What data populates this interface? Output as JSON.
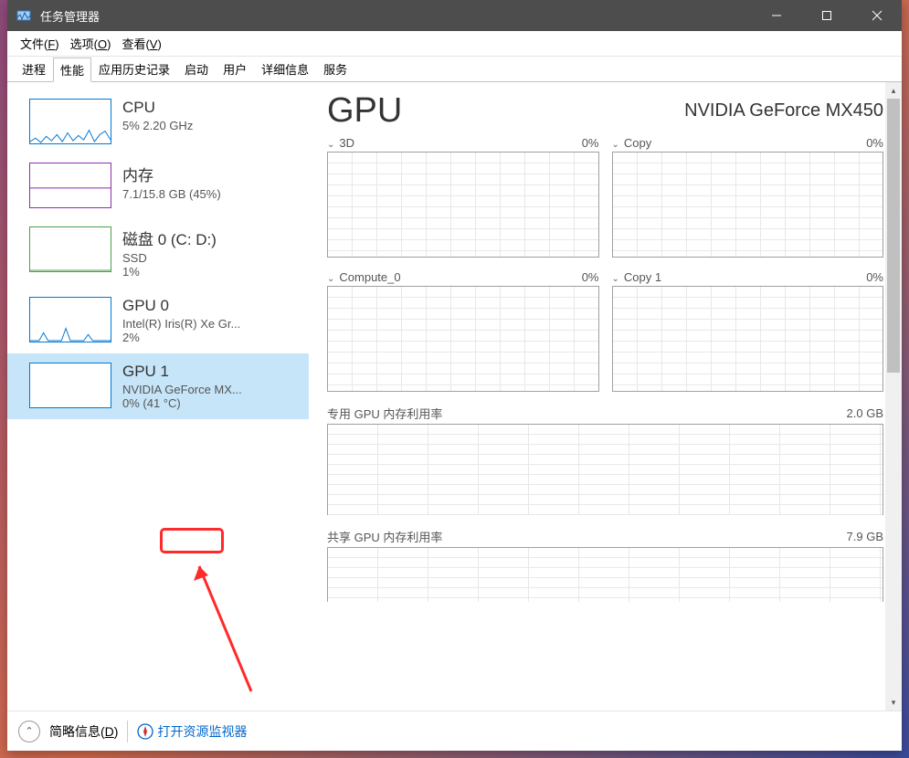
{
  "window": {
    "title": "任务管理器"
  },
  "menu": {
    "file": "文件(F)",
    "options": "选项(O)",
    "view": "查看(V)"
  },
  "tabs": {
    "processes": "进程",
    "performance": "性能",
    "app_history": "应用历史记录",
    "startup": "启动",
    "users": "用户",
    "details": "详细信息",
    "services": "服务"
  },
  "sidebar": {
    "cpu": {
      "title": "CPU",
      "sub": "5%  2.20 GHz"
    },
    "mem": {
      "title": "内存",
      "sub": "7.1/15.8 GB (45%)"
    },
    "disk": {
      "title": "磁盘 0 (C: D:)",
      "sub1": "SSD",
      "sub2": "1%"
    },
    "gpu0": {
      "title": "GPU 0",
      "sub1": "Intel(R) Iris(R) Xe Gr...",
      "sub2": "2%"
    },
    "gpu1": {
      "title": "GPU 1",
      "sub1": "NVIDIA GeForce MX...",
      "sub2a": "0% ",
      "sub2b": "(41 °C)"
    }
  },
  "main": {
    "title": "GPU",
    "subtitle": "NVIDIA GeForce MX450",
    "charts": {
      "3d": {
        "label": "3D",
        "value": "0%"
      },
      "copy": {
        "label": "Copy",
        "value": "0%"
      },
      "compute": {
        "label": "Compute_0",
        "value": "0%"
      },
      "copy1": {
        "label": "Copy 1",
        "value": "0%"
      },
      "dedicated": {
        "label": "专用 GPU 内存利用率",
        "value": "2.0 GB"
      },
      "shared": {
        "label": "共享 GPU 内存利用率",
        "value": "7.9 GB"
      }
    }
  },
  "statusbar": {
    "fewer": "简略信息(D)",
    "resmon": "打开资源监视器"
  },
  "chart_data": {
    "type": "line",
    "title": "GPU activity over time",
    "panels": [
      {
        "name": "3D",
        "ylim": [
          0,
          100
        ],
        "unit": "%",
        "current": 0,
        "series": [
          0,
          0,
          0,
          0,
          0,
          0,
          0,
          0,
          0,
          0
        ]
      },
      {
        "name": "Copy",
        "ylim": [
          0,
          100
        ],
        "unit": "%",
        "current": 0,
        "series": [
          0,
          0,
          0,
          0,
          0,
          0,
          0,
          0,
          0,
          0
        ]
      },
      {
        "name": "Compute_0",
        "ylim": [
          0,
          100
        ],
        "unit": "%",
        "current": 0,
        "series": [
          0,
          0,
          0,
          0,
          0,
          0,
          0,
          0,
          0,
          0
        ]
      },
      {
        "name": "Copy 1",
        "ylim": [
          0,
          100
        ],
        "unit": "%",
        "current": 0,
        "series": [
          0,
          0,
          0,
          0,
          0,
          0,
          0,
          0,
          0,
          0
        ]
      },
      {
        "name": "专用 GPU 内存利用率",
        "ylim": [
          0,
          2.0
        ],
        "unit": "GB",
        "current": 0,
        "series": [
          0,
          0,
          0,
          0,
          0,
          0,
          0,
          0,
          0,
          0
        ]
      },
      {
        "name": "共享 GPU 内存利用率",
        "ylim": [
          0,
          7.9
        ],
        "unit": "GB",
        "current": 0,
        "series": [
          0,
          0,
          0,
          0,
          0,
          0,
          0,
          0,
          0,
          0
        ]
      }
    ]
  }
}
